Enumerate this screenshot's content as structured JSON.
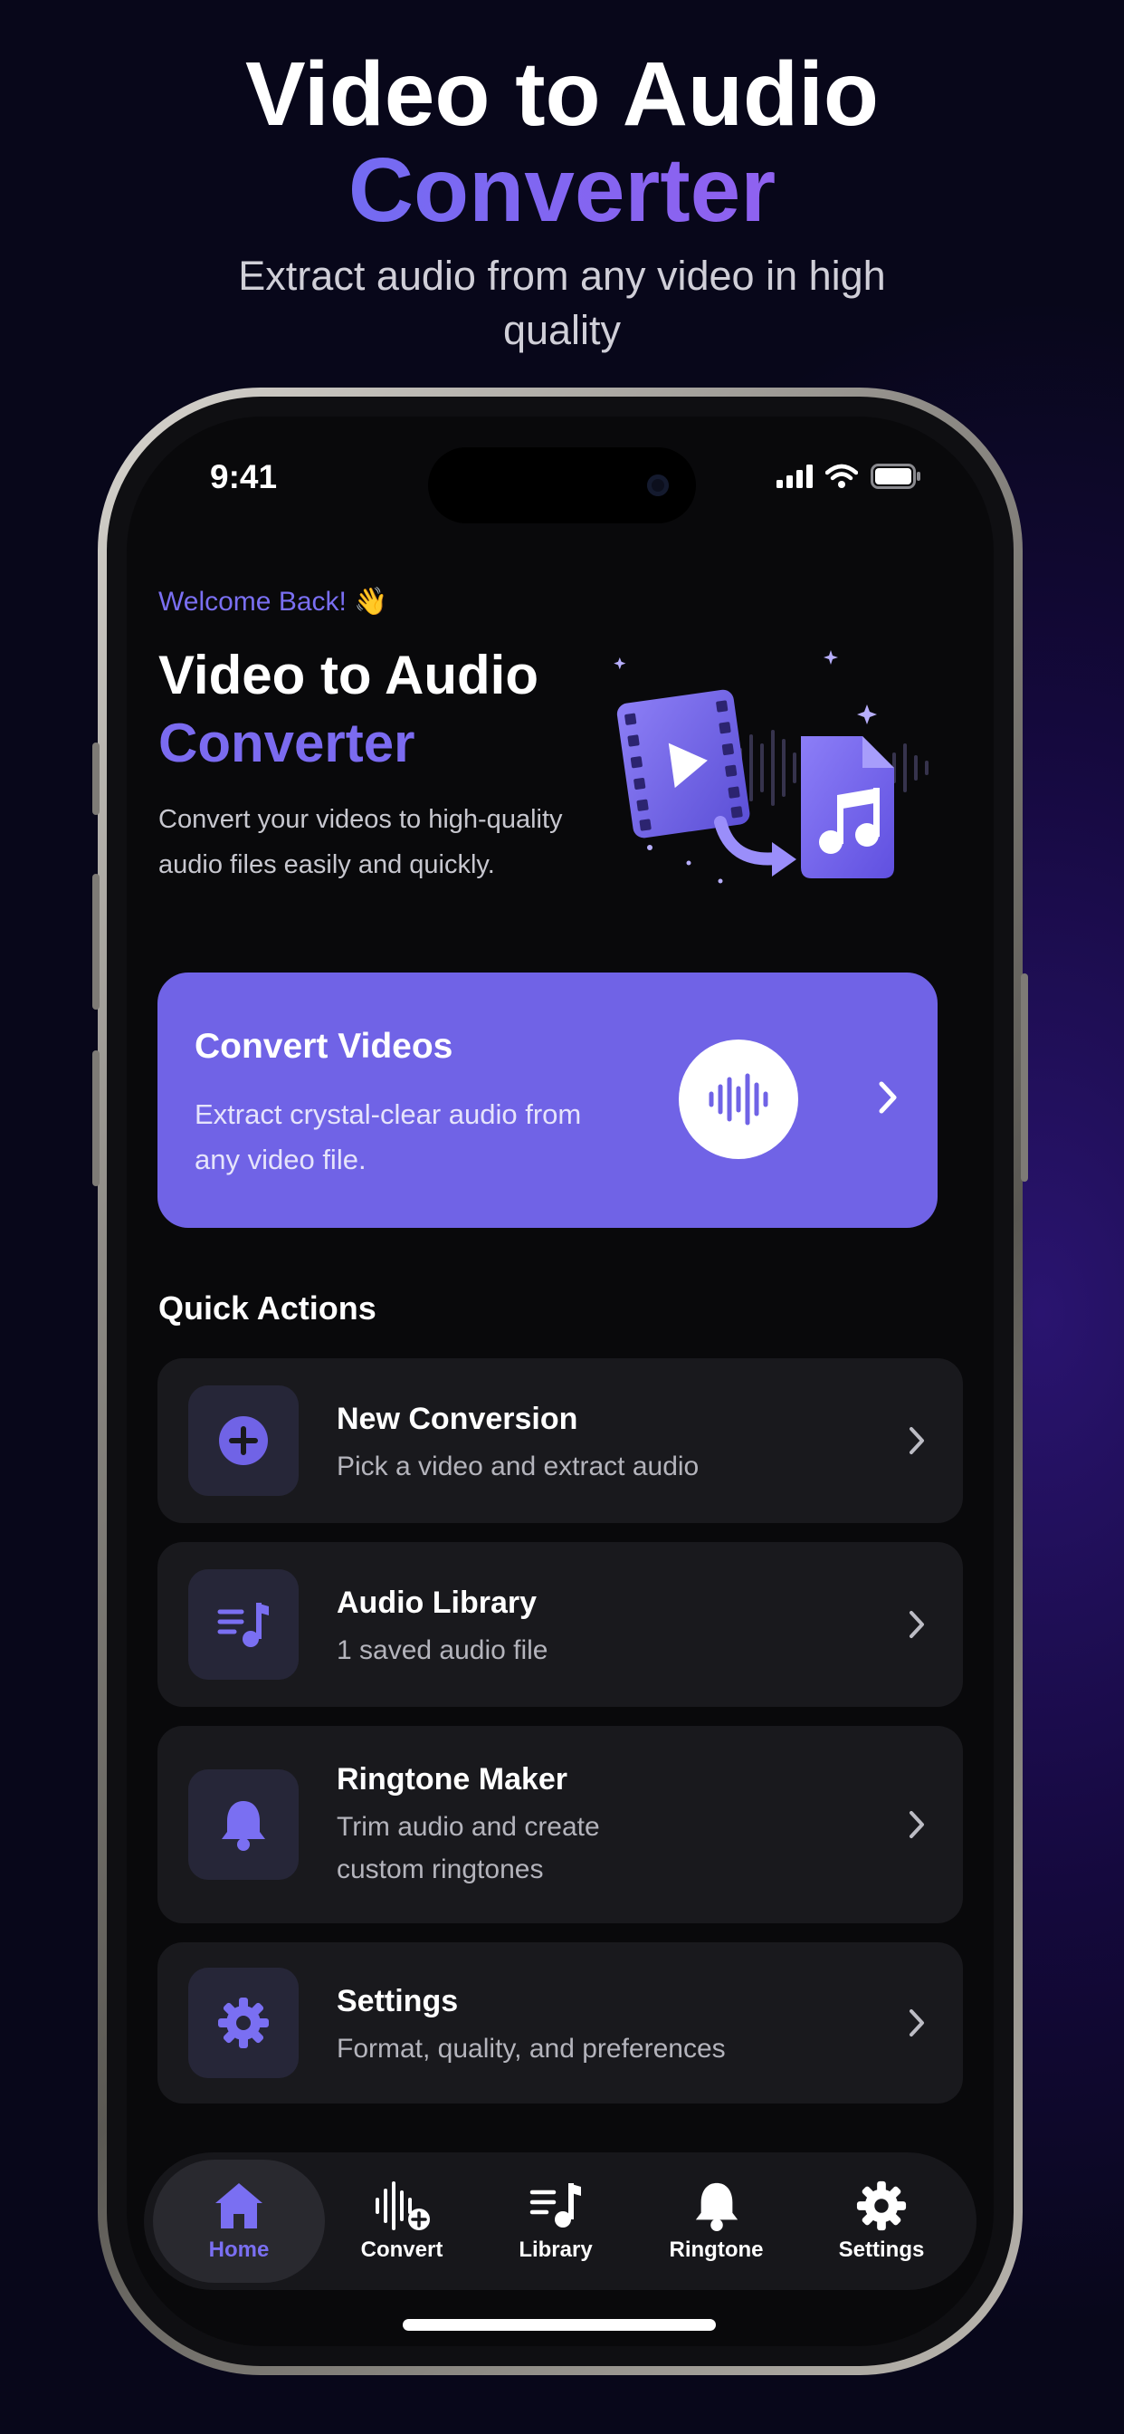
{
  "promo": {
    "title_line1": "Video to Audio",
    "title_line2": "Converter",
    "subtitle": "Extract audio from any video in high quality"
  },
  "status_bar": {
    "time": "9:41"
  },
  "hero": {
    "welcome": "Welcome Back! 👋",
    "title_line1": "Video to Audio",
    "title_line2": "Converter",
    "description": "Convert your videos to high-quality audio files easily and quickly."
  },
  "convert_card": {
    "title": "Convert Videos",
    "subtitle": "Extract crystal-clear audio from any video file."
  },
  "quick_actions": {
    "heading": "Quick Actions",
    "items": [
      {
        "title": "New Conversion",
        "subtitle": "Pick a video and extract audio",
        "icon": "plus-circle-icon"
      },
      {
        "title": "Audio Library",
        "subtitle": "1 saved audio file",
        "icon": "music-list-icon"
      },
      {
        "title": "Ringtone Maker",
        "subtitle": "Trim audio and create custom ringtones",
        "icon": "bell-icon"
      },
      {
        "title": "Settings",
        "subtitle": "Format, quality, and preferences",
        "icon": "gear-icon"
      }
    ]
  },
  "tabbar": {
    "tabs": [
      {
        "label": "Home",
        "icon": "home-icon",
        "active": true
      },
      {
        "label": "Convert",
        "icon": "waveform-plus-icon",
        "active": false
      },
      {
        "label": "Library",
        "icon": "music-list-icon",
        "active": false
      },
      {
        "label": "Ringtone",
        "icon": "bell-icon",
        "active": false
      },
      {
        "label": "Settings",
        "icon": "gear-icon",
        "active": false
      }
    ]
  },
  "colors": {
    "accent": "#7063e6",
    "accent_text": "#7a6ff2",
    "background": "#09090b",
    "card": "#19191d"
  }
}
